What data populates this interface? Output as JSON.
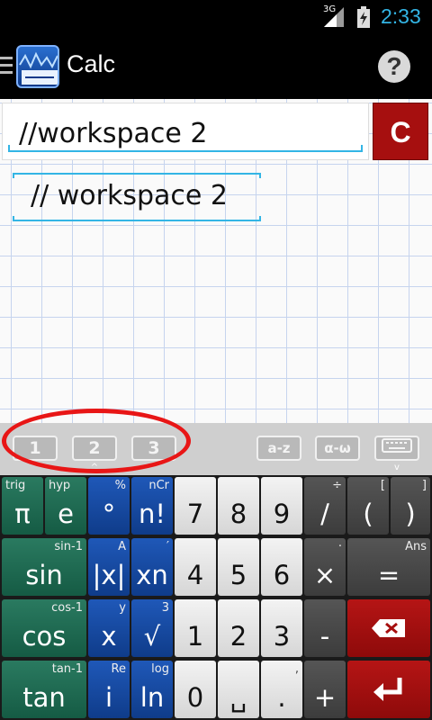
{
  "status": {
    "network": "3G",
    "time": "2:33"
  },
  "app": {
    "title": "Calc",
    "help_label": "?"
  },
  "input": {
    "value": "//workspace 2",
    "clear_label": "C"
  },
  "result": {
    "text": "// workspace 2"
  },
  "toolbar": {
    "workspaces": [
      "1",
      "2",
      "3"
    ],
    "alpha_label": "a-z",
    "greek_label": "α-ω"
  },
  "keys": {
    "pi": {
      "main": "π",
      "sup": "trig"
    },
    "e": {
      "main": "e",
      "sup": "hyp"
    },
    "degree": {
      "main": "°",
      "sup": "%"
    },
    "fact": {
      "main": "n!",
      "sup": "nCr"
    },
    "k7": "7",
    "k8": "8",
    "k9": "9",
    "div": {
      "main": "/",
      "sup": "÷"
    },
    "lparen": {
      "main": "(",
      "sup": "["
    },
    "rparen": {
      "main": ")",
      "sup": "]"
    },
    "sin": {
      "main": "sin",
      "sup": "sin-1"
    },
    "abs": {
      "main": "|x|",
      "sup": "A"
    },
    "pow": {
      "main": "xn",
      "sup": "′"
    },
    "k4": "4",
    "k5": "5",
    "k6": "6",
    "mul": {
      "main": "×",
      "sup": "·"
    },
    "eq": {
      "main": "=",
      "sup": "Ans"
    },
    "cos": {
      "main": "cos",
      "sup": "cos-1"
    },
    "x": {
      "main": "x",
      "sup": "y"
    },
    "sqrt": {
      "main": "√",
      "sup": "3"
    },
    "k1": "1",
    "k2": "2",
    "k3": "3",
    "minus": {
      "main": "-"
    },
    "tan": {
      "main": "tan",
      "sup": "tan-1"
    },
    "i": {
      "main": "i",
      "sup": "Re"
    },
    "ln": {
      "main": "ln",
      "sup": "log"
    },
    "k0": "0",
    "space": {
      "main": "␣"
    },
    "dot": {
      "main": ".",
      "sup": ","
    },
    "plus": {
      "main": "+"
    }
  },
  "colors": {
    "accent": "#33b5e5",
    "clear": "#a60f0f",
    "annotation": "#e81616"
  }
}
